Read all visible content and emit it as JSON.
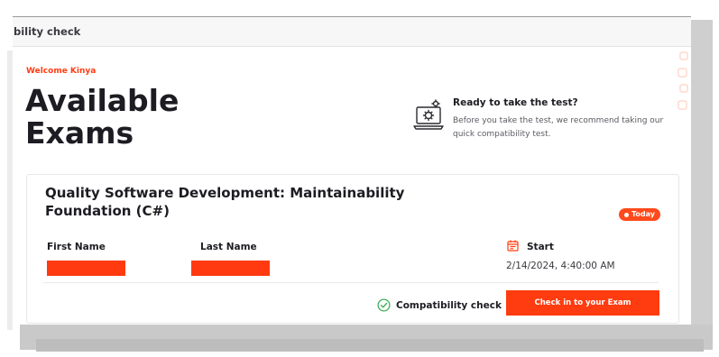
{
  "window": {
    "title": "bility check"
  },
  "header": {
    "welcome": "Welcome Kinya",
    "title_line1": "Available",
    "title_line2": "Exams"
  },
  "readiness": {
    "icon": "laptop-gear-icon",
    "title": "Ready to take the test?",
    "description": "Before you take the test, we recommend taking our quick compatibility test."
  },
  "exam": {
    "title": "Quality Software Development: Maintainability Foundation (C#)",
    "badge": "Today",
    "first_name_label": "First Name",
    "last_name_label": "Last Name",
    "start_label": "Start",
    "start_icon": "calendar-icon",
    "start_value": "2/14/2024, 4:40:00 AM",
    "compat_icon": "check-circle-icon",
    "compat_label": "Compatibility check",
    "checkin_label": "Check in to your Exam"
  },
  "colors": {
    "accent": "#ff3c0f",
    "text": "#1c1c22",
    "muted": "#5a5a62"
  }
}
